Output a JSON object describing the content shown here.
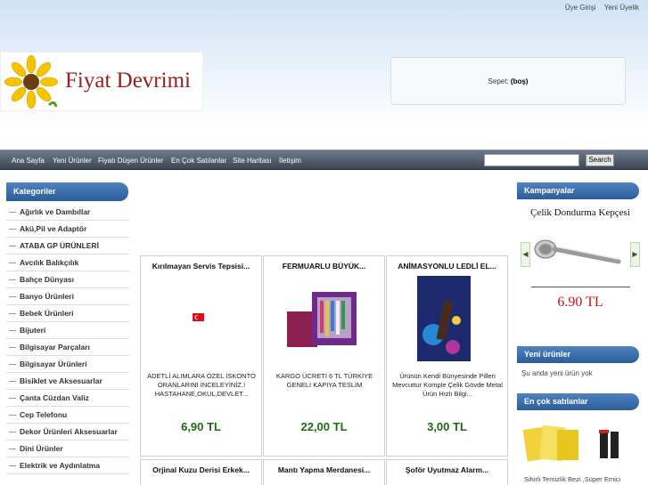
{
  "header": {
    "top_links": [
      "Üye Girişi",
      "Yeni Üyelik"
    ],
    "logo_text": "Fiyat Devrimi",
    "cart_label": "Sepet:",
    "cart_value": "(boş)"
  },
  "nav": {
    "items": [
      "Ana Sayfa",
      "Yeni Ürünler",
      "Fiyatı Düşen Ürünler",
      "En Çok Satılanlar",
      "Site Haritası",
      "İletişim"
    ],
    "search_button": "Search"
  },
  "sidebar": {
    "title": "Kategoriler",
    "items": [
      "Ağırlık ve Dambıllar",
      "Akü,Pil ve Adaptör",
      "ATABA GP ÜRÜNLERİ",
      "Avcılık Balıkçılık",
      "Bahçe Dünyası",
      "Banyo Ürünleri",
      "Bebek Ürünleri",
      "Bijuteri",
      "Bilgisayar Parçaları",
      "Bilgisayar Ürünleri",
      "Bisiklet ve Aksesuarlar",
      "Çanta Cüzdan Valiz",
      "Cep Telefonu",
      "Dekor Ürünleri Aksesuarlar",
      "Dini Ürünler",
      "Elektrik ve Aydınlatma"
    ]
  },
  "products": [
    {
      "title": "Kırılmayan Servis Tepsisi...",
      "desc": "ADETLİ ALIMLARA ÖZEL İSKONTO ORANLARINI İNCELEYİNİZ.! HASTAHANE,OKUL,DEVLET...",
      "price": "6,90 TL"
    },
    {
      "title": "FERMUARLU BÜYÜK...",
      "desc": "KARGO ÜCRETİ 6 TL TÜRKİYE GENELİ KAPIYA TESLİM",
      "price": "22,00 TL"
    },
    {
      "title": "ANİMASYONLU LEDLİ EL...",
      "desc": "Ürünün Kendi Bünyesinde Pilleri Mevcuttur Komple Çelik Gövde Metal Ürün Hızlı Bilgi...",
      "price": "3,00 TL"
    },
    {
      "title": "Orjinal Kuzu Derisi Erkek..."
    },
    {
      "title": "Mantı Yapma Merdanesi..."
    },
    {
      "title": "Şoför Uyutmaz Alarm..."
    }
  ],
  "right": {
    "campaign_title": "Kampanyalar",
    "campaign_product": "Çelik Dondurma Kepçesi",
    "campaign_price": "6.90 TL",
    "new_title": "Yeni ürünler",
    "new_text": "Şu anda yeni ürün yok",
    "best_title": "En çok satılanlar",
    "best_caption": "Sihirli Temizlik Bezi ,Süper Emici"
  }
}
